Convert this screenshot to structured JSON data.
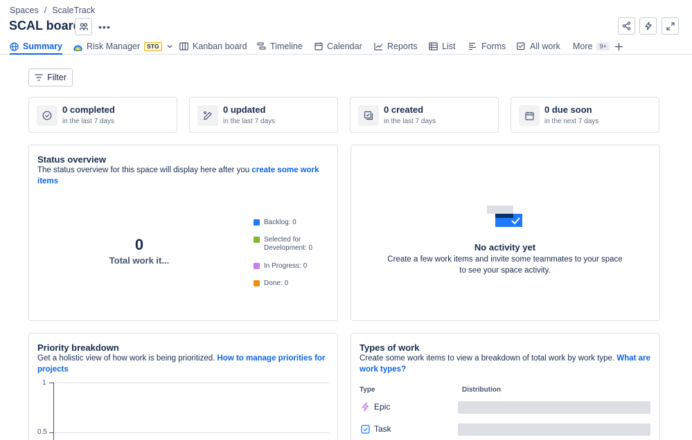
{
  "breadcrumb": {
    "root": "Spaces",
    "separator": "/",
    "current": "ScaleTrack"
  },
  "page": {
    "title": "SCAL board"
  },
  "tabs": [
    {
      "label": "Summary",
      "icon": "globe-icon",
      "active": true
    },
    {
      "label": "Risk Manager",
      "icon": "risk-manager-app-icon",
      "badge": "STG"
    },
    {
      "label": "Kanban board",
      "icon": "board-icon"
    },
    {
      "label": "Timeline",
      "icon": "timeline-icon"
    },
    {
      "label": "Calendar",
      "icon": "calendar-icon"
    },
    {
      "label": "Reports",
      "icon": "chart-line-icon"
    },
    {
      "label": "List",
      "icon": "list-icon"
    },
    {
      "label": "Forms",
      "icon": "forms-icon"
    },
    {
      "label": "All work",
      "icon": "all-work-icon"
    },
    {
      "label": "More",
      "count": "9+"
    }
  ],
  "filter": {
    "label": "Filter"
  },
  "stats": [
    {
      "value": "0 completed",
      "caption": "in the last 7 days",
      "icon": "check-circle-icon"
    },
    {
      "value": "0 updated",
      "caption": "in the last 7 days",
      "icon": "edit-icon"
    },
    {
      "value": "0 created",
      "caption": "in the last 7 days",
      "icon": "created-icon"
    },
    {
      "value": "0 due soon",
      "caption": "in the next 7 days",
      "icon": "calendar-icon"
    }
  ],
  "status_overview": {
    "title": "Status overview",
    "description": "The status overview for this space will display here after you ",
    "link": "create some work items",
    "total_value": "0",
    "total_label": "Total work it...",
    "legend": [
      {
        "label": "Backlog: 0",
        "color": "#1d7afc"
      },
      {
        "label": "Selected for Development: 0",
        "color": "#82b536"
      },
      {
        "label": "In Progress: 0",
        "color": "#c97cf4"
      },
      {
        "label": "Done: 0",
        "color": "#f18d13"
      }
    ]
  },
  "activity": {
    "title": "No activity yet",
    "description": "Create a few work items and invite some teammates to your space to see your space activity."
  },
  "priority": {
    "title": "Priority breakdown",
    "description": "Get a holistic view of how work is being prioritized. ",
    "link": "How to manage priorities for projects",
    "y_ticks": [
      "1",
      "0.5"
    ]
  },
  "types": {
    "title": "Types of work",
    "description": "Create some work items to view a breakdown of total work by work type. ",
    "link": "What are work types?",
    "col_type": "Type",
    "col_distribution": "Distribution",
    "rows": [
      {
        "label": "Epic",
        "icon": "epic-icon",
        "color": "#c97cf4"
      },
      {
        "label": "Task",
        "icon": "task-icon",
        "color": "#1d7afc"
      }
    ]
  }
}
